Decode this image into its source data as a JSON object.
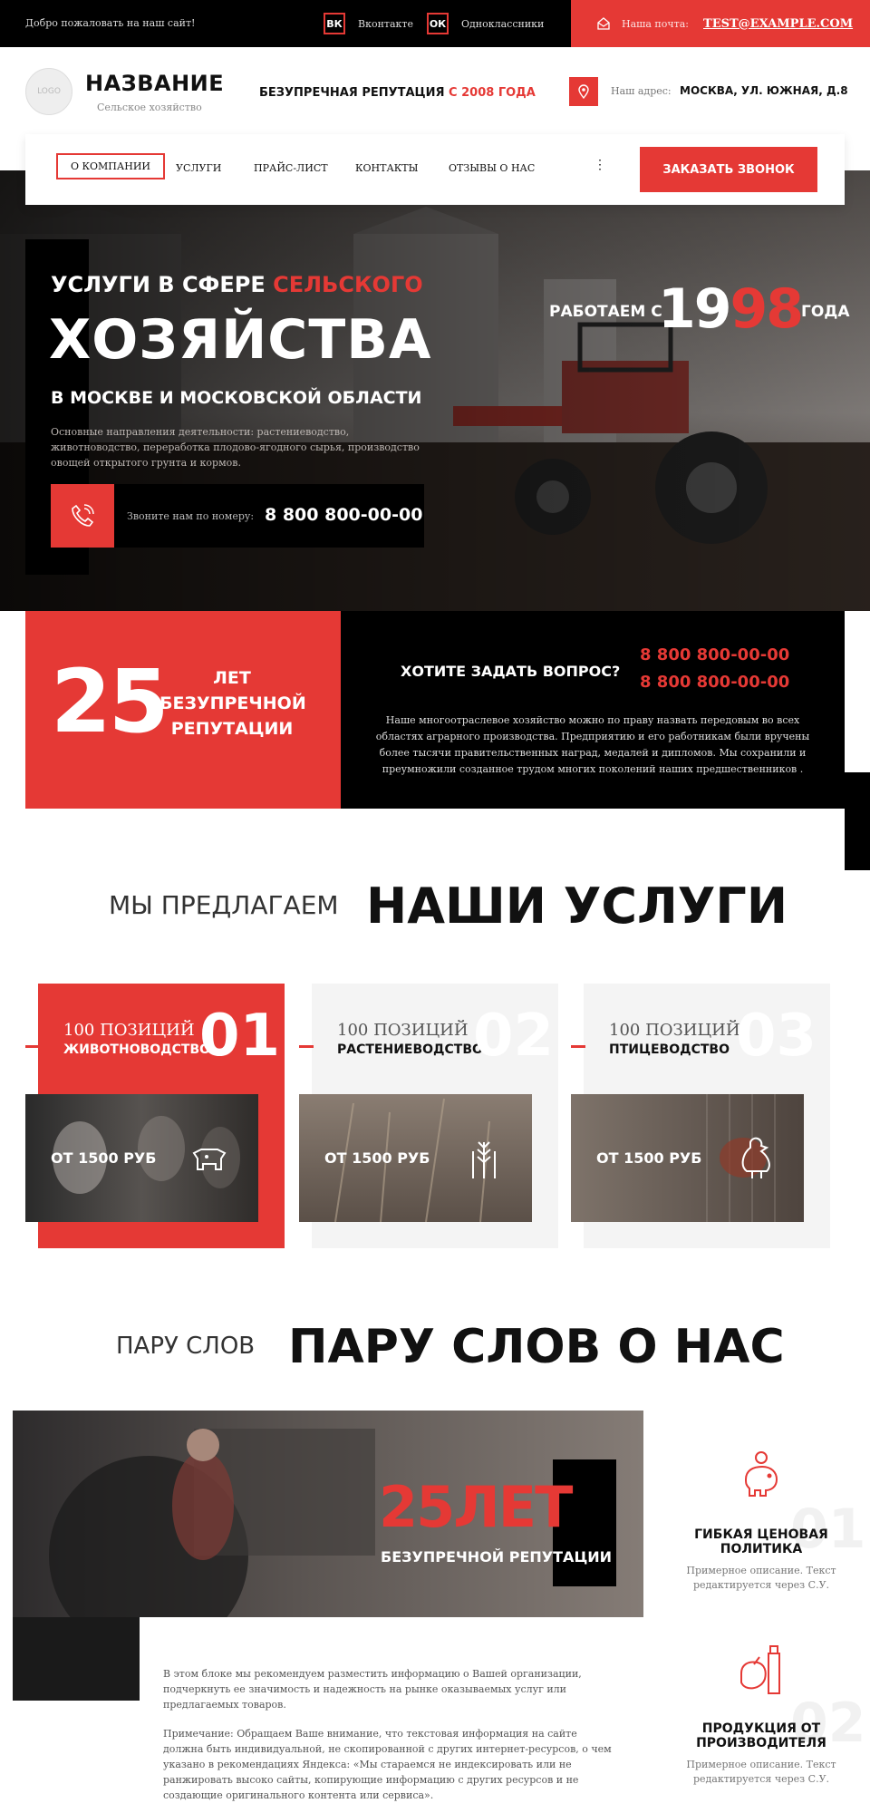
{
  "topbar": {
    "welcome": "Добро пожаловать на наш сайт!",
    "vk_icon": "vk-icon",
    "vk_label": "Вконтакте",
    "ok_icon": "odnoklassniki-icon",
    "ok_label": "Одноклассники",
    "mail_label": "Наша почта:",
    "mail_value": "TEST@EXAMPLE.COM"
  },
  "header": {
    "logo": "LOGO",
    "brand": "НАЗВАНИЕ",
    "subtitle": "Сельское хозяйство",
    "reputation_prefix": "БЕЗУПРЕЧНАЯ РЕПУТАЦИЯ ",
    "reputation_suffix": "С 2008 ГОДА",
    "address_label": "Наш адрес:",
    "address_value": "МОСКВА, УЛ. ЮЖНАЯ, Д.8"
  },
  "nav": {
    "items": [
      "О КОМПАНИИ",
      "УСЛУГИ",
      "ПРАЙС-ЛИСТ",
      "КОНТАКТЫ",
      "ОТЗЫВЫ О НАС"
    ],
    "more": "⋮",
    "call_button": "ЗАКАЗАТЬ ЗВОНОК"
  },
  "hero": {
    "line1_a": "УСЛУГИ В СФЕРЕ ",
    "line1_b": "СЕЛЬСКОГО",
    "line2": "ХОЗЯЙСТВА",
    "line3": "В МОСКВЕ И МОСКОВСКОЙ ОБЛАСТИ",
    "desc": "Основные направления деятельности: растениеводство, животноводство, переработка плодово-ягодного сырья, производство овощей открытого грунта и кормов.",
    "phone_label": "Звоните нам по номеру:",
    "phone": "8 800 800-00-00",
    "since_prefix": "РАБОТАЕМ С",
    "since_a": "19",
    "since_b": "98",
    "since_suffix": "ГОДА"
  },
  "stats": {
    "number": "25",
    "line1": "ЛЕТ",
    "line2": "БЕЗУПРЕЧНОЙ",
    "line3": "РЕПУТАЦИИ"
  },
  "question": {
    "title": "ХОТИТЕ ЗАДАТЬ ВОПРОС?",
    "phone1": "8 800 800-00-00",
    "phone2": "8 800 800-00-00",
    "text": "Наше многоотраслевое хозяйство можно по праву назвать передовым во всех областях аграрного производства. Предприятию и его работникам были вручены более тысячи правительственных наград, медалей и дипломов. Мы сохранили и преумножили созданное трудом многих поколений наших предшественников ."
  },
  "services": {
    "pre": "МЫ ПРЕДЛАГАЕМ",
    "title": "НАШИ УСЛУГИ",
    "cards": [
      {
        "positions": "100 ПОЗИЦИЙ",
        "category": "ЖИВОТНОВОДСТВО",
        "number": "01",
        "price": "ОТ 1500 РУБ",
        "icon": "cow-icon"
      },
      {
        "positions": "100 ПОЗИЦИЙ",
        "category": "РАСТЕНИЕВОДСТВО",
        "number": "02",
        "price": "ОТ 1500 РУБ",
        "icon": "wheat-icon"
      },
      {
        "positions": "100 ПОЗИЦИЙ",
        "category": "ПТИЦЕВОДСТВО",
        "number": "03",
        "price": "ОТ 1500 РУБ",
        "icon": "chicken-icon"
      }
    ]
  },
  "about": {
    "pre": "ПАРУ СЛОВ",
    "title": "ПАРУ СЛОВ О НАС",
    "badge": "25ЛЕТ",
    "badge_sub": "БЕЗУПРЕЧНОЙ РЕПУТАЦИИ",
    "p1": "В этом блоке мы рекомендуем разместить информацию о Вашей организации, подчеркнуть ее значимость и надежность на рынке оказываемых услуг или предлагаемых товаров.",
    "p2": "Примечание: Обращаем Ваше внимание, что текстовая информация на сайте должна быть индивидуальной, не скопированной с других интернет-ресурсов, о чем указано в рекомендациях Яндекса: «Мы стараемся не индексировать или не ранжировать высоко сайты, копирующие информацию с других ресурсов и не создающие оригинального контента или сервиса».",
    "features": [
      {
        "num": "01",
        "title": "ГИБКАЯ ЦЕНОВАЯ ПОЛИТИКА",
        "desc": "Примерное описание. Текст редактируется через С.У.",
        "icon": "piggy-bank-icon"
      },
      {
        "num": "02",
        "title": "ПРОДУКЦИЯ ОТ ПРОИЗВОДИТЕЛЯ",
        "desc": "Примерное описание. Текст редактируется через С.У.",
        "icon": "food-products-icon"
      }
    ]
  },
  "colors": {
    "accent": "#e53935",
    "dark": "#000000"
  }
}
